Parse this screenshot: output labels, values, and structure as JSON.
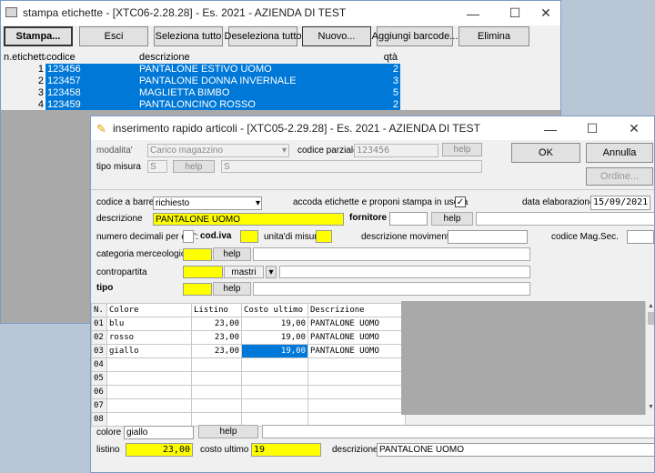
{
  "win1": {
    "title": "stampa etichette - [XTC06-2.28.28] - Es. 2021 - AZIENDA DI TEST",
    "buttons": [
      "Stampa...",
      "Esci",
      "Seleziona tutto",
      "Deseleziona tutto",
      "Nuovo...",
      "Aggiungi barcode...",
      "Elimina"
    ],
    "columns": [
      "n.etichetta",
      "codice",
      "descrizione",
      "qtà"
    ],
    "rows": [
      {
        "n": "1",
        "codice": "123456",
        "descrizione": "PANTALONE ESTIVO UOMO",
        "qta": "2"
      },
      {
        "n": "2",
        "codice": "123457",
        "descrizione": "PANTALONE DONNA INVERNALE",
        "qta": "3"
      },
      {
        "n": "3",
        "codice": "123458",
        "descrizione": "MAGLIETTA BIMBO",
        "qta": "5"
      },
      {
        "n": "4",
        "codice": "123459",
        "descrizione": "PANTALONCINO ROSSO",
        "qta": "2"
      }
    ]
  },
  "win2": {
    "title": "inserimento rapido articoli - [XTC05-2.29.28] - Es. 2021 - AZIENDA DI TEST",
    "modalita_label": "modalita'",
    "modalita_value": "Carico magazzino",
    "codice_parziale_label": "codice parziale",
    "codice_parziale_value": "123456",
    "help": "help",
    "ok": "OK",
    "annulla": "Annulla",
    "ordine": "Ordine...",
    "tipo_misura_label": "tipo misura",
    "tipo_misura_value": "S",
    "tipo_misura_desc": "S",
    "codice_barre_label": "codice a barre",
    "codice_barre_value": "richiesto",
    "accoda_label": "accoda etichette e proponi stampa in uscita",
    "check": "✓",
    "data_elab_label": "data elaborazione",
    "data_elab_value": "15/09/2021",
    "descrizione_label": "descrizione",
    "descrizione_value": "PANTALONE UOMO",
    "fornitore_label": "fornitore",
    "decimali_label": "numero decimali per qta':",
    "codiva_label": "cod.iva",
    "um_label": "unita'di misura",
    "desc_mov_label": "descrizione movimenti",
    "codice_magsec_label": "codice Mag.Sec.",
    "categoria_label": "categoria merceologica",
    "contropartita_label": "contropartita",
    "mastri_value": "mastri",
    "tipo_label": "tipo",
    "grid_headers": [
      "N.",
      "Colore",
      "Listino",
      "Costo ultimo",
      "Descrizione"
    ],
    "grid_rows": [
      {
        "n": "01",
        "colore": "blu",
        "listino": "23,00",
        "costo": "19,00",
        "descrizione": "PANTALONE UOMO"
      },
      {
        "n": "02",
        "colore": "rosso",
        "listino": "23,00",
        "costo": "19,00",
        "descrizione": "PANTALONE UOMO"
      },
      {
        "n": "03",
        "colore": "giallo",
        "listino": "23,00",
        "costo": "19,00",
        "descrizione": "PANTALONE UOMO"
      },
      {
        "n": "04",
        "colore": "",
        "listino": "",
        "costo": "",
        "descrizione": ""
      },
      {
        "n": "05",
        "colore": "",
        "listino": "",
        "costo": "",
        "descrizione": ""
      },
      {
        "n": "06",
        "colore": "",
        "listino": "",
        "costo": "",
        "descrizione": ""
      },
      {
        "n": "07",
        "colore": "",
        "listino": "",
        "costo": "",
        "descrizione": ""
      },
      {
        "n": "08",
        "colore": "",
        "listino": "",
        "costo": "",
        "descrizione": ""
      }
    ],
    "colore_label": "colore",
    "colore_value": "giallo",
    "listino_label": "listino",
    "listino_value": "23,00",
    "costo_ultimo_label": "costo ultimo",
    "costo_ultimo_value": "19",
    "descrizione2_label": "descrizione",
    "descrizione2_value": "PANTALONE UOMO"
  }
}
